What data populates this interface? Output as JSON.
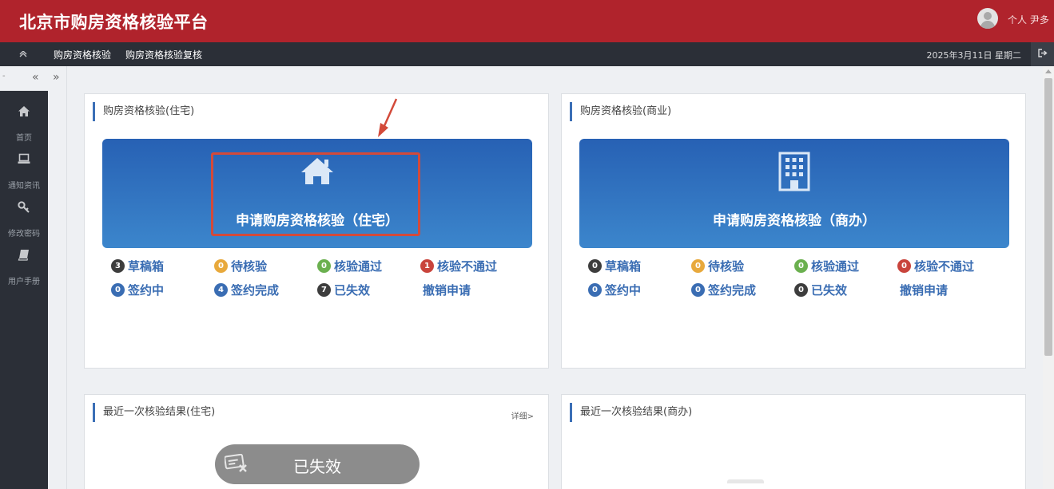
{
  "header": {
    "title": "北京市购房资格核验平台",
    "user_label": "个人 尹多"
  },
  "navbar": {
    "items": [
      "购房资格核验",
      "购房资格核验复核"
    ],
    "date": "2025年3月11日 星期二"
  },
  "sidebar": {
    "items": [
      {
        "label": "首页",
        "icon": "home-icon"
      },
      {
        "label": "通知资讯",
        "icon": "laptop-icon"
      },
      {
        "label": "修改密码",
        "icon": "key-icon"
      },
      {
        "label": "用户手册",
        "icon": "book-icon"
      }
    ]
  },
  "residential": {
    "title": "购房资格核验(住宅)",
    "apply_label": "申请购房资格核验（住宅）",
    "statuses": [
      {
        "count": "3",
        "label": "草稿箱",
        "color": "#3d3d3d"
      },
      {
        "count": "0",
        "label": "待核验",
        "color": "#e8a93c"
      },
      {
        "count": "0",
        "label": "核验通过",
        "color": "#6bb04f"
      },
      {
        "count": "1",
        "label": "核验不通过",
        "color": "#c9443c"
      },
      {
        "count": "0",
        "label": "签约中",
        "color": "#3a6db3"
      },
      {
        "count": "4",
        "label": "签约完成",
        "color": "#3a6db3"
      },
      {
        "count": "7",
        "label": "已失效",
        "color": "#3d3d3d"
      }
    ],
    "cancel_label": "撤销申请"
  },
  "commercial": {
    "title": "购房资格核验(商业)",
    "apply_label": "申请购房资格核验（商办）",
    "statuses": [
      {
        "count": "0",
        "label": "草稿箱",
        "color": "#3d3d3d"
      },
      {
        "count": "0",
        "label": "待核验",
        "color": "#e8a93c"
      },
      {
        "count": "0",
        "label": "核验通过",
        "color": "#6bb04f"
      },
      {
        "count": "0",
        "label": "核验不通过",
        "color": "#c9443c"
      },
      {
        "count": "0",
        "label": "签约中",
        "color": "#3a6db3"
      },
      {
        "count": "0",
        "label": "签约完成",
        "color": "#3a6db3"
      },
      {
        "count": "0",
        "label": "已失效",
        "color": "#3d3d3d"
      }
    ],
    "cancel_label": "撤销申请"
  },
  "latest_residential": {
    "title": "最近一次核验结果(住宅)",
    "detail_label": "详细>",
    "result": "已失效"
  },
  "latest_commercial": {
    "title": "最近一次核验结果(商办)"
  },
  "colors": {
    "brand_red": "#b0232c",
    "nav_dark": "#2b2f37",
    "accent_blue": "#3a6db3",
    "highlight_red": "#d34a3a"
  }
}
